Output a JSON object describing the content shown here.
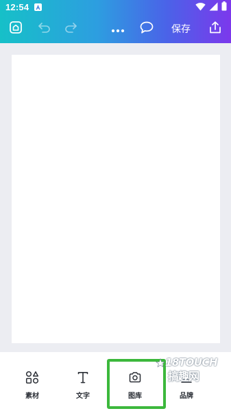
{
  "status_bar": {
    "time": "12:54",
    "icons": [
      "notification-a-icon",
      "wifi-icon",
      "signal-icon",
      "battery-icon"
    ]
  },
  "toolbar": {
    "icons": [
      "home-icon",
      "undo-icon",
      "redo-icon",
      "more-icon",
      "comment-icon",
      "share-icon"
    ],
    "save_label": "保存"
  },
  "bottom_bar": {
    "tools": [
      {
        "label": "素材",
        "icon": "shapes-icon"
      },
      {
        "label": "文字",
        "icon": "text-icon"
      },
      {
        "label": "图库",
        "icon": "camera-icon"
      },
      {
        "label": "品牌",
        "icon": "brand-icon"
      }
    ]
  },
  "highlight": {
    "target": "图库",
    "color": "#3cb83c"
  },
  "watermark": {
    "line1": "18TOUCH",
    "line2": "搞趣网"
  },
  "colors": {
    "gradient_start": "#16c0c8",
    "gradient_end": "#7c38ec",
    "canvas_background": "#ecedf2",
    "page": "#ffffff"
  }
}
